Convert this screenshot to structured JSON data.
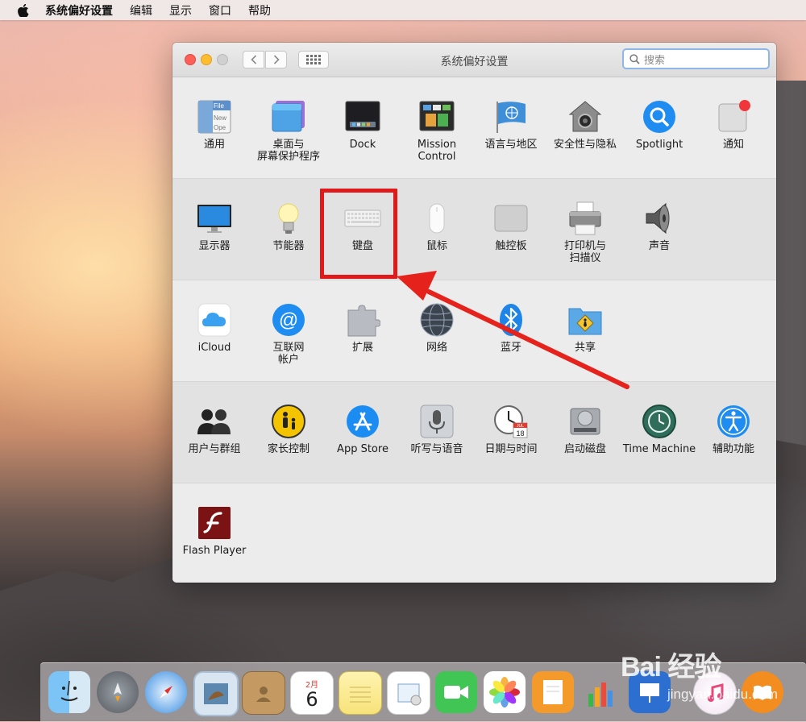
{
  "menubar": {
    "app_name": "系统偏好设置",
    "items": [
      "编辑",
      "显示",
      "窗口",
      "帮助"
    ]
  },
  "window": {
    "title": "系统偏好设置",
    "search_placeholder": "搜索"
  },
  "sections": [
    {
      "panes": [
        {
          "id": "general",
          "label": "通用",
          "icon": "general-icon"
        },
        {
          "id": "desktop",
          "label": "桌面与\n屏幕保护程序",
          "icon": "desktop-screensaver-icon"
        },
        {
          "id": "dock",
          "label": "Dock",
          "icon": "dock-icon"
        },
        {
          "id": "mission",
          "label": "Mission\nControl",
          "icon": "mission-control-icon"
        },
        {
          "id": "language",
          "label": "语言与地区",
          "icon": "language-region-icon"
        },
        {
          "id": "security",
          "label": "安全性与隐私",
          "icon": "security-privacy-icon"
        },
        {
          "id": "spotlight",
          "label": "Spotlight",
          "icon": "spotlight-icon"
        },
        {
          "id": "notifications",
          "label": "通知",
          "icon": "notifications-icon"
        }
      ]
    },
    {
      "panes": [
        {
          "id": "displays",
          "label": "显示器",
          "icon": "display-icon"
        },
        {
          "id": "energy",
          "label": "节能器",
          "icon": "energy-saver-icon"
        },
        {
          "id": "keyboard",
          "label": "键盘",
          "icon": "keyboard-icon"
        },
        {
          "id": "mouse",
          "label": "鼠标",
          "icon": "mouse-icon"
        },
        {
          "id": "trackpad",
          "label": "触控板",
          "icon": "trackpad-icon"
        },
        {
          "id": "printers",
          "label": "打印机与\n扫描仪",
          "icon": "printer-scanner-icon"
        },
        {
          "id": "sound",
          "label": "声音",
          "icon": "sound-icon"
        }
      ]
    },
    {
      "panes": [
        {
          "id": "icloud",
          "label": "iCloud",
          "icon": "icloud-icon"
        },
        {
          "id": "internet",
          "label": "互联网\n帐户",
          "icon": "internet-accounts-icon"
        },
        {
          "id": "extensions",
          "label": "扩展",
          "icon": "extensions-icon"
        },
        {
          "id": "network",
          "label": "网络",
          "icon": "network-icon"
        },
        {
          "id": "bluetooth",
          "label": "蓝牙",
          "icon": "bluetooth-icon"
        },
        {
          "id": "sharing",
          "label": "共享",
          "icon": "sharing-icon"
        }
      ]
    },
    {
      "panes": [
        {
          "id": "users",
          "label": "用户与群组",
          "icon": "users-groups-icon"
        },
        {
          "id": "parental",
          "label": "家长控制",
          "icon": "parental-controls-icon"
        },
        {
          "id": "appstore",
          "label": "App Store",
          "icon": "app-store-icon"
        },
        {
          "id": "dictation",
          "label": "听写与语音",
          "icon": "dictation-speech-icon"
        },
        {
          "id": "datetime",
          "label": "日期与时间",
          "icon": "date-time-icon"
        },
        {
          "id": "startup",
          "label": "启动磁盘",
          "icon": "startup-disk-icon"
        },
        {
          "id": "timemachine",
          "label": "Time Machine",
          "icon": "time-machine-icon"
        },
        {
          "id": "accessibility",
          "label": "辅助功能",
          "icon": "accessibility-icon"
        }
      ]
    },
    {
      "panes": [
        {
          "id": "flash",
          "label": "Flash Player",
          "icon": "flash-player-icon"
        }
      ]
    }
  ],
  "icon_text": {
    "general_file": "File",
    "general_new": "New",
    "general_open": "Ope",
    "calendar_month": "JUL",
    "calendar_day": "18",
    "dock_calendar_month": "2月",
    "dock_calendar_day": "6"
  },
  "dock": {
    "apps": [
      "finder-icon",
      "launchpad-icon",
      "safari-icon",
      "mail-icon",
      "contacts-icon",
      "calendar-icon",
      "notes-icon",
      "reminders-icon",
      "facetime-icon",
      "photos-icon",
      "pages-icon",
      "numbers-icon",
      "keynote-icon",
      "itunes-icon",
      "ibooks-icon"
    ]
  },
  "watermark": {
    "brand": "Bai 经验",
    "url": "jingyan.baidu.com"
  },
  "colors": {
    "highlight": "#e0191a",
    "search_focus": "#8fb6ea"
  }
}
